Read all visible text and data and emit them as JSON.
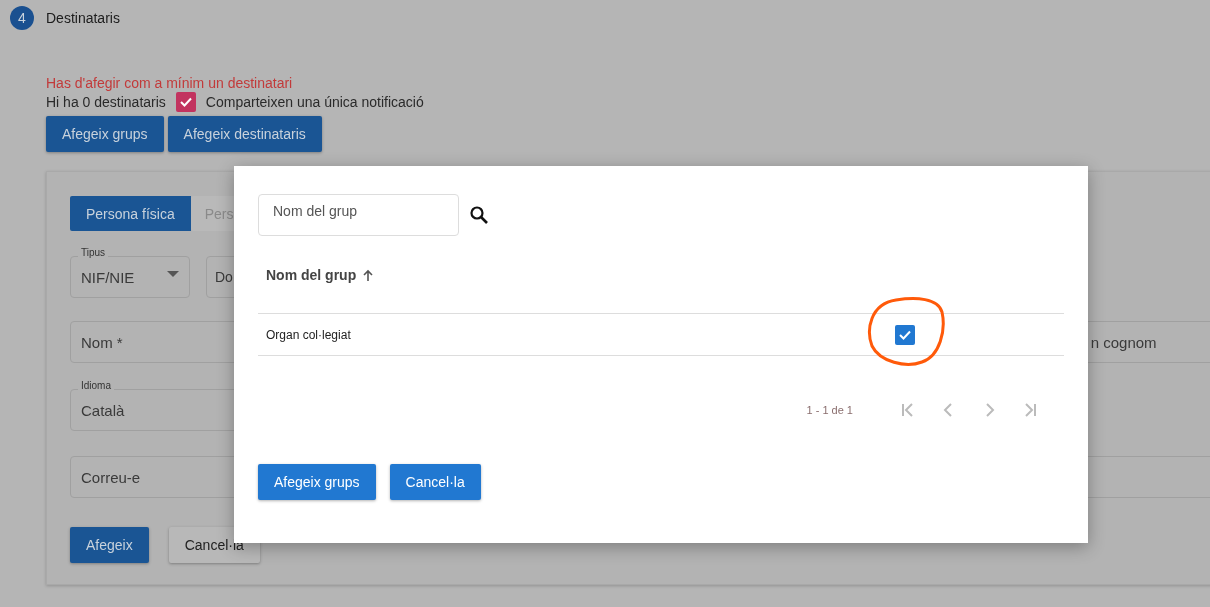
{
  "step": {
    "number": "4",
    "title": "Destinataris"
  },
  "error": "Has d'afegir com a mínim un destinatari",
  "count_text": "Hi ha 0 destinataris",
  "share_checkbox": {
    "label": "Comparteixen una única notificació",
    "checked": true
  },
  "actions": [
    "Afegeix grups",
    "Afegeix destinataris"
  ],
  "form": {
    "tabs": [
      {
        "label": "Persona física",
        "selected": true
      },
      {
        "label": "Pers",
        "selected": false
      }
    ],
    "type_select": {
      "label": "Tipus",
      "value": "NIF/NIE"
    },
    "document_field": {
      "placeholder": "Do"
    },
    "name_field": {
      "placeholder": "Nom *"
    },
    "surname_field": {
      "placeholder": "n cognom"
    },
    "language_field": {
      "label": "Idioma",
      "value": "Català"
    },
    "email_field": {
      "placeholder": "Correu-e"
    },
    "buttons": [
      "Afegeix",
      "Cancel·la"
    ]
  },
  "dialog": {
    "search": {
      "placeholder": "Nom del grup"
    },
    "table": {
      "column": "Nom del grup",
      "rows": [
        {
          "name": "Organ col·legiat",
          "selected": true
        }
      ]
    },
    "pagination": "1 - 1 de 1",
    "buttons": [
      "Afegeix grups",
      "Cancel·la"
    ]
  }
}
